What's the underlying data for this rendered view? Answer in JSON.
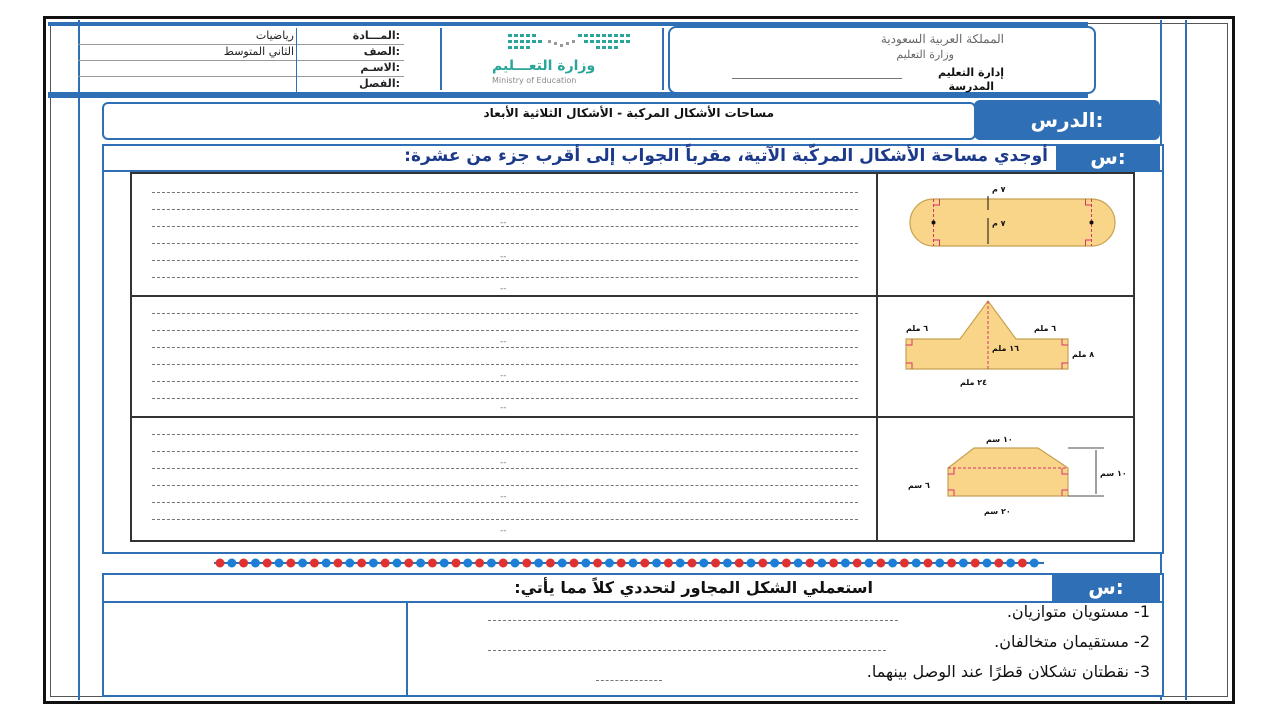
{
  "header": {
    "kingdom_name": "المملكة العربية السعودية",
    "ministry_name": "وزارة التعليم",
    "ministry_en": "Ministry of Education",
    "ministry_ar_logo": "وزارة التعـــليم",
    "edu_admin_label": "إدارة التعليم",
    "school_label": "المدرسة",
    "subject_label": "المـــادة:",
    "subject_value": "رياضيات",
    "grade_label": "الصف:",
    "grade_value": "الثاني المتوسط",
    "name_label": "الاسـم:",
    "class_label": "الفصل:"
  },
  "lesson": {
    "label": "الدرس:",
    "title": "مساحات الأشكال المركبة  -  الأشكال الثلاثية الأبعاد"
  },
  "question1": {
    "label": "س:",
    "text": "أوجدي مساحة الأشكال المركّبة الآتية، مقرباً الجواب إلى أقرب جزء من عشرة:",
    "figures": [
      {
        "labels": [
          "٧ م",
          "٧ م"
        ]
      },
      {
        "labels": [
          "٦ ملم",
          "٦ ملم",
          "١٦ ملم",
          "٨ ملم",
          "٢٤ ملم"
        ]
      },
      {
        "labels": [
          "١٠ سم",
          "١٠ سم",
          "٦ سم",
          "٢٠ سم"
        ]
      }
    ],
    "answer_dash": "--"
  },
  "question2": {
    "label": "س:",
    "text": "استعملي الشكل المجاور لتحددي كلاً مما يأتي:",
    "items": [
      "1- مستويان متوازيان.",
      "2- مستقيمان متخالفان.",
      "3- نقطتان تشكلان قطرًا عند الوصل بينهما."
    ]
  },
  "colors": {
    "accent": "#2f6fb5",
    "figure_fill": "#f9d58a",
    "figure_dash": "#d6336c",
    "title_text": "#1b3a8a"
  }
}
